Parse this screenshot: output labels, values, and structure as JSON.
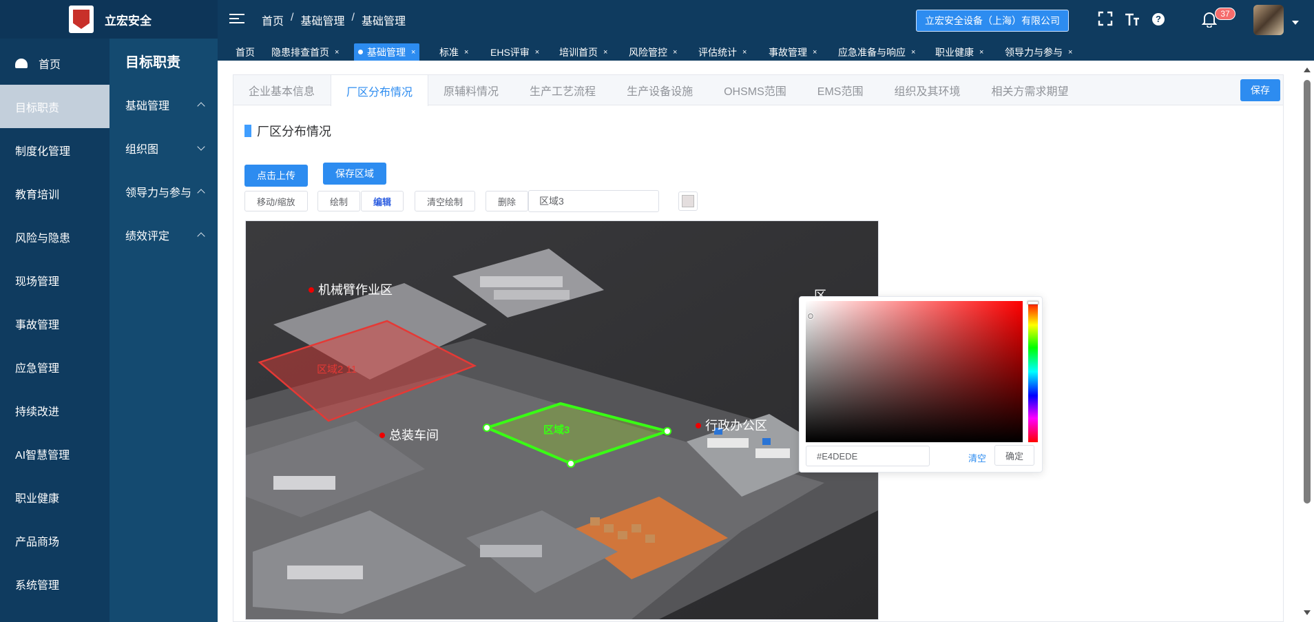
{
  "app": {
    "brand": "立宏安全",
    "company": "立宏安全设备（上海）有限公司",
    "notification_count": "37"
  },
  "breadcrumb": [
    "首页",
    "基础管理",
    "基础管理"
  ],
  "breadcrumb_sep": "/",
  "tags": [
    {
      "label": "首页",
      "closable": false
    },
    {
      "label": "隐患排查首页",
      "closable": true
    },
    {
      "label": "基础管理",
      "closable": true,
      "active": true
    },
    {
      "label": "标准",
      "closable": true
    },
    {
      "label": "EHS评审",
      "closable": true
    },
    {
      "label": "培训首页",
      "closable": true
    },
    {
      "label": "风险管控",
      "closable": true
    },
    {
      "label": "评估统计",
      "closable": true
    },
    {
      "label": "事故管理",
      "closable": true
    },
    {
      "label": "应急准备与响应",
      "closable": true
    },
    {
      "label": "职业健康",
      "closable": true
    },
    {
      "label": "领导力与参与",
      "closable": true
    }
  ],
  "tag_close": "×",
  "side1": {
    "home": "首页",
    "items": [
      "目标职责",
      "制度化管理",
      "教育培训",
      "风险与隐患",
      "现场管理",
      "事故管理",
      "应急管理",
      "持续改进",
      "AI智慧管理",
      "职业健康",
      "产品商场",
      "系统管理"
    ]
  },
  "side2": {
    "title": "目标职责",
    "items": [
      "基础管理",
      "组织图",
      "领导力与参与",
      "绩效评定"
    ]
  },
  "tabs": [
    "企业基本信息",
    "厂区分布情况",
    "原辅料情况",
    "生产工艺流程",
    "生产设备设施",
    "OHSMS范围",
    "EMS范围",
    "组织及其环境",
    "相关方需求期望"
  ],
  "save_label": "保存",
  "section_title": "厂区分布情况",
  "upload_label": "点击上传",
  "save_region_label": "保存区域",
  "tools": [
    "移动/缩放",
    "绘制",
    "编辑",
    "清空绘制",
    "删除"
  ],
  "region_name": "区域3",
  "plant_labels": {
    "arm_area": "机械臂作业区",
    "assembly": "总装车间",
    "office": "行政办公区",
    "partial_area": "区",
    "region_red": "区域2 11",
    "region_green": "区域3"
  },
  "color_picker": {
    "hex": "#E4DEDE",
    "clear": "清空",
    "confirm": "确定"
  },
  "colors": {
    "header_bg": "#0f3b5f",
    "side2_bg": "#144a70",
    "accent": "#2d8cf0",
    "region_red": "#e53935",
    "region_green": "#39ff14"
  }
}
